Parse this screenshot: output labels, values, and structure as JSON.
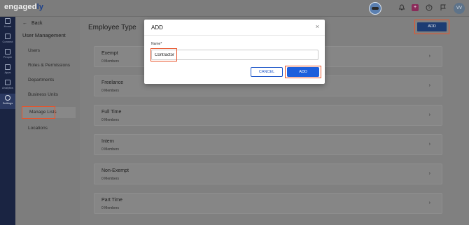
{
  "brand": {
    "name_prefix": "engaged",
    "name_suffix": "ly"
  },
  "topbar": {
    "badge": "+",
    "avatar_initials": "VV"
  },
  "rail": [
    {
      "label": "Home",
      "icon": "home-icon"
    },
    {
      "label": "Connect",
      "icon": "connect-icon"
    },
    {
      "label": "People",
      "icon": "people-icon"
    },
    {
      "label": "Apps",
      "icon": "apps-icon"
    },
    {
      "label": "Analytics",
      "icon": "analytics-icon"
    },
    {
      "label": "Settings",
      "icon": "gear-icon",
      "active": true
    }
  ],
  "sidebar": {
    "back_label": "Back",
    "title": "User Management",
    "items": [
      {
        "label": "Users"
      },
      {
        "label": "Roles & Permissions"
      },
      {
        "label": "Departments"
      },
      {
        "label": "Business Units"
      },
      {
        "label": "Manage Lists",
        "active": true
      },
      {
        "label": "Locations"
      }
    ]
  },
  "main": {
    "title": "Employee Type",
    "add_label": "ADD",
    "types": [
      {
        "name": "Exempt",
        "members": "0 Members"
      },
      {
        "name": "Freelance",
        "members": "0 Members"
      },
      {
        "name": "Full Time",
        "members": "0 Members"
      },
      {
        "name": "Intern",
        "members": "0 Members"
      },
      {
        "name": "Non-Exempt",
        "members": "0 Members"
      },
      {
        "name": "Part Time",
        "members": "0 Members"
      }
    ]
  },
  "modal": {
    "title": "ADD",
    "close": "×",
    "field_label": "Name*",
    "field_value": "Contractor",
    "cancel_label": "CANCEL",
    "submit_label": "ADD"
  },
  "colors": {
    "highlight": "#e8532a",
    "primary": "#1d5fdc",
    "rail_bg": "#1a2442"
  }
}
